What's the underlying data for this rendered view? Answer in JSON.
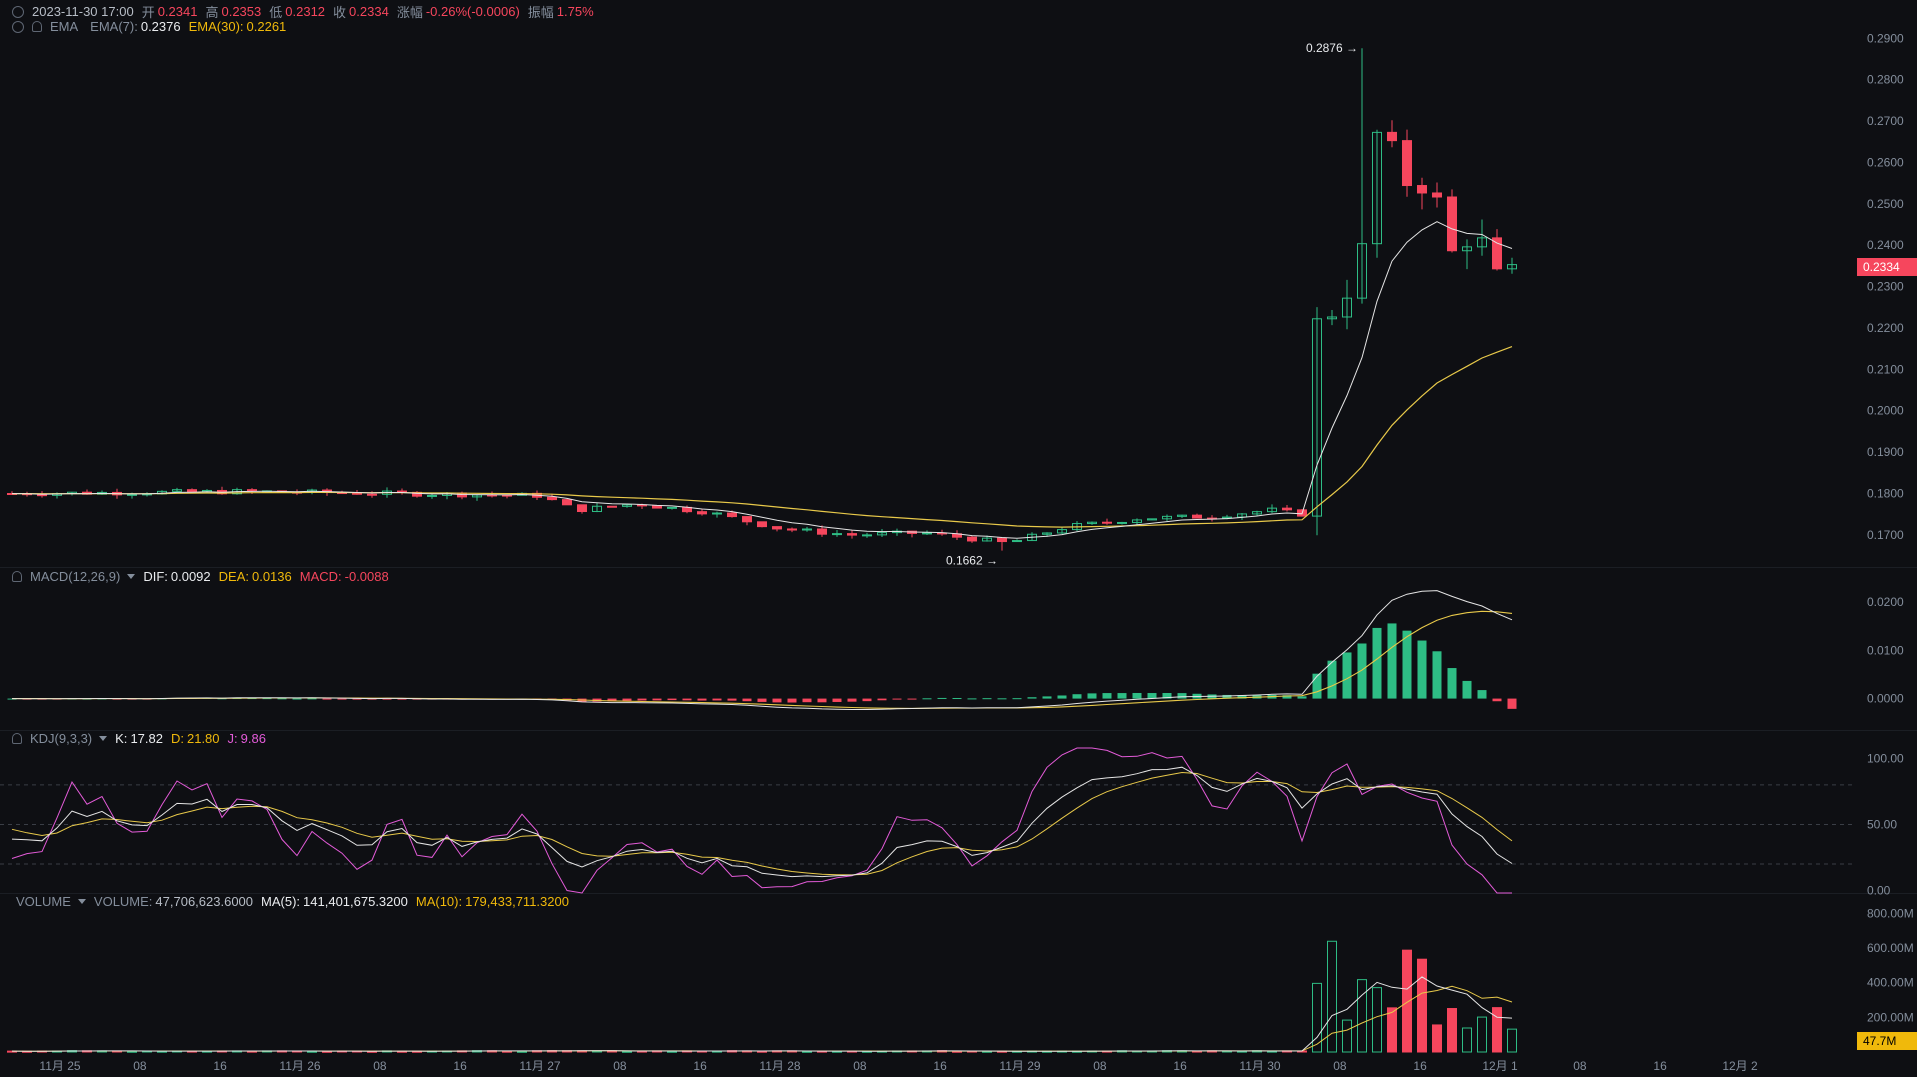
{
  "header": {
    "datetime": "2023-11-30 17:00",
    "open_label": "开",
    "open": "0.2341",
    "high_label": "高",
    "high": "0.2353",
    "low_label": "低",
    "low": "0.2312",
    "close_label": "收",
    "close": "0.2334",
    "change_label": "涨幅",
    "change": "-0.26%(-0.0006)",
    "amplitude_label": "振幅",
    "amplitude": "1.75%"
  },
  "ema_legend": {
    "name": "EMA",
    "ema7_label": "EMA(7):",
    "ema7": "0.2376",
    "ema30_label": "EMA(30):",
    "ema30": "0.2261"
  },
  "macd_legend": {
    "name": "MACD(12,26,9)",
    "dif_label": "DIF:",
    "dif": "0.0092",
    "dea_label": "DEA:",
    "dea": "0.0136",
    "macd_label": "MACD:",
    "macd": "-0.0088"
  },
  "kdj_legend": {
    "name": "KDJ(9,3,3)",
    "k_label": "K:",
    "k": "17.82",
    "d_label": "D:",
    "d": "21.80",
    "j_label": "J:",
    "j": "9.86"
  },
  "volume_legend": {
    "name": "VOLUME",
    "vol_label": "VOLUME:",
    "vol": "47,706,623.6000",
    "ma5_label": "MA(5):",
    "ma5": "141,401,675.3200",
    "ma10_label": "MA(10):",
    "ma10": "179,433,711.3200"
  },
  "current_price_tag": "0.2334",
  "current_volume_tag": "47.7M",
  "colors": {
    "up": "#2ebd85",
    "down": "#f6465d",
    "ema7": "#e5e5e5",
    "ema30": "#e8c94a",
    "k": "#e5e5e5",
    "d": "#e8c94a",
    "j": "#e35bd8",
    "grid": "#1e2127",
    "axis_text": "#848e9c"
  },
  "chart_data": [
    {
      "type": "candlestick",
      "pane": "price",
      "indicators": [
        "EMA(7)",
        "EMA(30)"
      ],
      "ylim": [
        0.162,
        0.292
      ],
      "y_ticks": [
        "0.1700",
        "0.1800",
        "0.1900",
        "0.2000",
        "0.2100",
        "0.2200",
        "0.2300",
        "0.2400",
        "0.2500",
        "0.2600",
        "0.2700",
        "0.2800",
        "0.2900"
      ],
      "annotations": [
        {
          "text": "0.2876 →",
          "value": 0.2876
        },
        {
          "text": "0.1662 →",
          "value": 0.1662
        }
      ],
      "x_ticks": [
        {
          "label": "11月 25",
          "day": 0.2
        },
        {
          "label": "08",
          "day": 0.533
        },
        {
          "label": "16",
          "day": 0.867
        },
        {
          "label": "11月 26",
          "day": 1.2
        },
        {
          "label": "08",
          "day": 1.533
        },
        {
          "label": "16",
          "day": 1.867
        },
        {
          "label": "11月 27",
          "day": 2.2
        },
        {
          "label": "08",
          "day": 2.533
        },
        {
          "label": "16",
          "day": 2.867
        },
        {
          "label": "11月 28",
          "day": 3.2
        },
        {
          "label": "08",
          "day": 3.533
        },
        {
          "label": "16",
          "day": 3.867
        },
        {
          "label": "11月 29",
          "day": 4.2
        },
        {
          "label": "08",
          "day": 4.533
        },
        {
          "label": "16",
          "day": 4.867
        },
        {
          "label": "11月 30",
          "day": 5.2
        },
        {
          "label": "08",
          "day": 5.533
        },
        {
          "label": "16",
          "day": 5.867
        },
        {
          "label": "12月 1",
          "day": 6.2
        },
        {
          "label": "08",
          "day": 6.533
        },
        {
          "label": "16",
          "day": 6.867
        },
        {
          "label": "12月 2",
          "day": 7.2
        }
      ],
      "price_keypoints": [
        [
          0,
          0.18
        ],
        [
          1.0,
          0.1805
        ],
        [
          1.6,
          0.18
        ],
        [
          2.2,
          0.1795
        ],
        [
          2.35,
          0.176
        ],
        [
          2.6,
          0.1775
        ],
        [
          2.9,
          0.1755
        ],
        [
          3.2,
          0.1715
        ],
        [
          3.5,
          0.17
        ],
        [
          3.8,
          0.1705
        ],
        [
          4.15,
          0.168
        ],
        [
          4.4,
          0.172
        ],
        [
          4.7,
          0.174
        ],
        [
          5.0,
          0.1745
        ],
        [
          5.25,
          0.176
        ],
        [
          5.38,
          0.175
        ],
        [
          5.42,
          0.22
        ],
        [
          5.52,
          0.225
        ],
        [
          5.62,
          0.235
        ],
        [
          5.66,
          0.264
        ],
        [
          5.72,
          0.27
        ],
        [
          5.78,
          0.255
        ],
        [
          5.86,
          0.256
        ],
        [
          5.94,
          0.25
        ],
        [
          6.0,
          0.238
        ],
        [
          6.1,
          0.244
        ],
        [
          6.18,
          0.232
        ],
        [
          6.28,
          0.2334
        ]
      ]
    },
    {
      "type": "bar+line",
      "pane": "MACD",
      "ylim": [
        -0.0065,
        0.0235
      ],
      "y_ticks": [
        "0.0000",
        "0.0100",
        "0.0200"
      ],
      "last": {
        "DIF": 0.0092,
        "DEA": 0.0136,
        "MACD": -0.0088
      }
    },
    {
      "type": "line",
      "pane": "KDJ",
      "ylim": [
        -2,
        108
      ],
      "y_ticks": [
        "0.00",
        "50.00",
        "100.00"
      ],
      "reference_lines": [
        20,
        50,
        80
      ],
      "last": {
        "K": 17.82,
        "D": 21.8,
        "J": 9.86
      }
    },
    {
      "type": "bar",
      "pane": "VOLUME",
      "ylim": [
        0,
        820000000
      ],
      "y_ticks": [
        "200.00M",
        "400.00M",
        "600.00M",
        "800.00M"
      ],
      "last": {
        "VOLUME": 47706623.6,
        "MA(5)": 141401675.32,
        "MA(10)": 179433711.32
      }
    }
  ]
}
